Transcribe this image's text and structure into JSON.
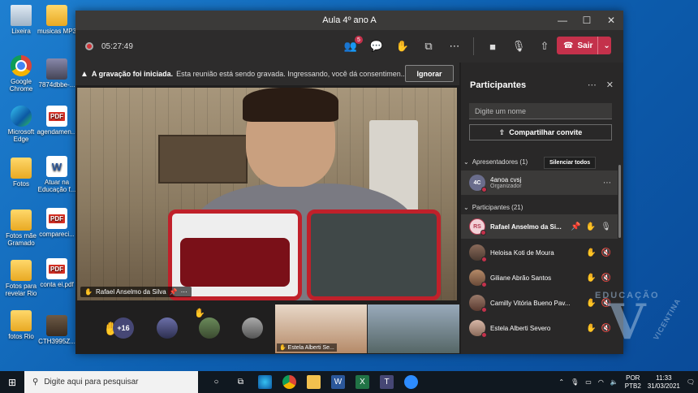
{
  "desktop": {
    "icons": [
      {
        "label": "Lixeira"
      },
      {
        "label": "musicas MP3"
      },
      {
        "label": "Google Chrome"
      },
      {
        "label": "7874dbbe-..."
      },
      {
        "label": "Microsoft Edge"
      },
      {
        "label": "agendamen..."
      },
      {
        "label": "Fotos"
      },
      {
        "label": "Atuar na Educação f..."
      },
      {
        "label": "Fotos mãe Gramado"
      },
      {
        "label": "compareci..."
      },
      {
        "label": "Fotos para revelar Rio"
      },
      {
        "label": "conta ei.pdf"
      },
      {
        "label": "fotos Rio"
      },
      {
        "label": "CTH3995Z..."
      }
    ],
    "pdf_label": "PDF",
    "word_label": "W"
  },
  "window": {
    "title": "Aula 4º ano A",
    "controls": {
      "minimize": "—",
      "maximize": "☐",
      "close": "✕"
    }
  },
  "callbar": {
    "timer": "05:27:49",
    "people_badge": "5",
    "leave_label": "Sair"
  },
  "banner": {
    "title": "A gravação foi iniciada.",
    "text": "Esta reunião está sendo gravada. Ingressando, você dá consentimen...",
    "ignore_label": "Ignorar"
  },
  "stage": {
    "speaker_name": "Rafael Anselmo da Silva"
  },
  "strip": {
    "overflow_count": "+16",
    "thumb1_name": "Estela Alberti Se..."
  },
  "panel": {
    "title": "Participantes",
    "search_placeholder": "Digite um nome",
    "share_label": "Compartilhar convite",
    "presenters_header": "Apresentadores (1)",
    "mute_all_label": "Silenciar todos",
    "presenter": {
      "initials": "4C",
      "name": "4anoa cvsj",
      "role": "Organizador"
    },
    "attendees_header": "Participantes (21)",
    "attendees": [
      {
        "initials": "RS",
        "name": "Rafael Anselmo da Si..."
      },
      {
        "initials": "",
        "name": "Heloisa Koti de Moura"
      },
      {
        "initials": "",
        "name": "Giliane Abrão Santos"
      },
      {
        "initials": "",
        "name": "Camilly Vitória Bueno Pav..."
      },
      {
        "initials": "",
        "name": "Estela Alberti Severo"
      }
    ]
  },
  "watermark": {
    "top": "EDUCAÇÃO",
    "letter": "V",
    "side": "VICENTINA"
  },
  "taskbar": {
    "search_placeholder": "Digite aqui para pesquisar",
    "lang_top": "POR",
    "lang_bottom": "PTB2",
    "time": "11:33",
    "date": "31/03/2021"
  }
}
